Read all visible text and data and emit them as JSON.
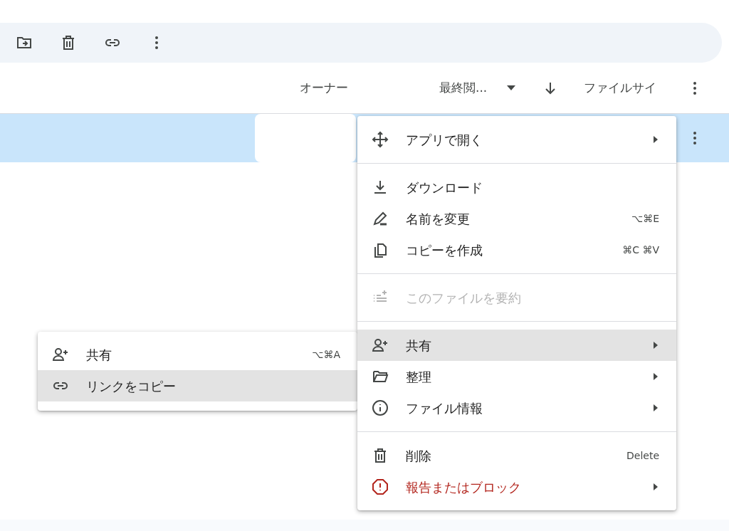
{
  "columns": [
    {
      "label": "オーナー"
    },
    {
      "label": "最終閲..."
    },
    {
      "label": "ファイルサイ"
    }
  ],
  "rows": [
    {
      "selected": true
    }
  ],
  "context_menu": {
    "sections": [
      {
        "items": [
          {
            "label": "アプリで開く",
            "has_submenu": true,
            "disabled": false,
            "selected": false,
            "danger": false
          }
        ]
      },
      {
        "items": [
          {
            "label": "ダウンロード",
            "has_submenu": false,
            "disabled": false,
            "selected": false,
            "danger": false
          },
          {
            "label": "名前を変更",
            "shortcut": "⌥⌘E",
            "has_submenu": false,
            "disabled": false,
            "selected": false,
            "danger": false
          },
          {
            "label": "コピーを作成",
            "shortcut": "⌘C ⌘V",
            "has_submenu": false,
            "disabled": false,
            "selected": false,
            "danger": false
          }
        ]
      },
      {
        "items": [
          {
            "label": "このファイルを要約",
            "has_submenu": false,
            "disabled": true,
            "selected": false,
            "danger": false
          }
        ]
      },
      {
        "items": [
          {
            "label": "共有",
            "has_submenu": true,
            "disabled": false,
            "selected": true,
            "danger": false
          },
          {
            "label": "整理",
            "has_submenu": true,
            "disabled": false,
            "selected": false,
            "danger": false
          },
          {
            "label": "ファイル情報",
            "has_submenu": true,
            "disabled": false,
            "selected": false,
            "danger": false
          }
        ]
      },
      {
        "items": [
          {
            "label": "削除",
            "shortcut": "Delete",
            "has_submenu": false,
            "disabled": false,
            "selected": false,
            "danger": false
          },
          {
            "label": "報告またはブロック",
            "has_submenu": true,
            "disabled": false,
            "selected": false,
            "danger": true
          }
        ]
      }
    ]
  },
  "submenu": {
    "items": [
      {
        "label": "共有",
        "shortcut": "⌥⌘A",
        "selected": false
      },
      {
        "label": "リンクをコピー",
        "selected": true
      }
    ]
  }
}
